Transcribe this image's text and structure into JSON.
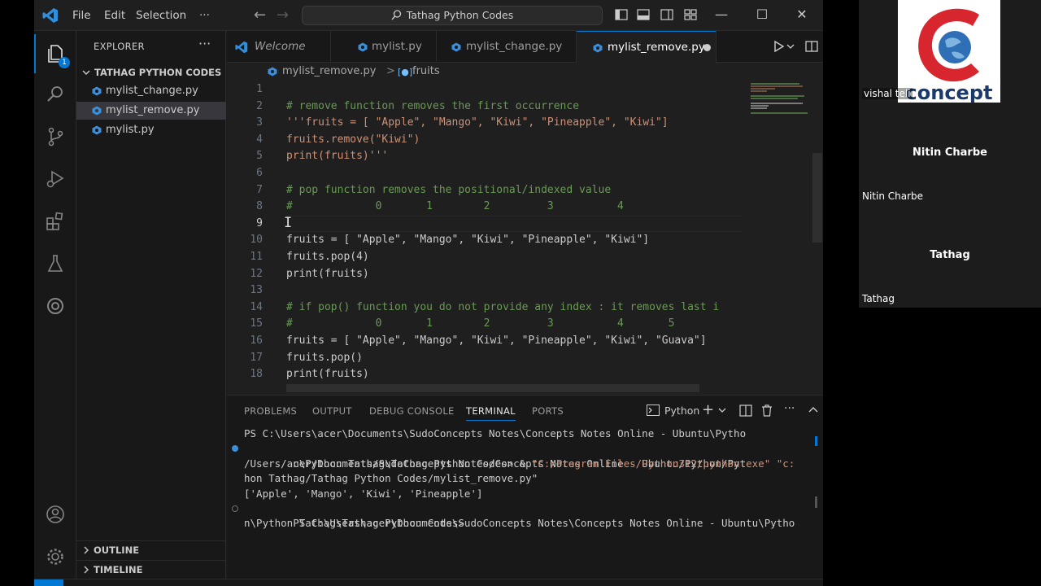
{
  "titlebar": {
    "menu": [
      "File",
      "Edit",
      "Selection",
      "···"
    ],
    "search": "Tathag Python Codes",
    "window_controls": [
      "minimize",
      "maximize",
      "close"
    ]
  },
  "activity_bar": {
    "items": [
      "explorer-icon",
      "search-icon",
      "source-control-icon",
      "run-debug-icon",
      "extensions-icon",
      "testing-icon",
      "remote-icon"
    ],
    "badge": "1",
    "bottom": [
      "account-icon",
      "gear-icon"
    ]
  },
  "sidebar": {
    "header": "EXPLORER",
    "more": "···",
    "folder": "TATHAG PYTHON CODES",
    "files": [
      "mylist_change.py",
      "mylist_remove.py",
      "mylist.py"
    ],
    "selected": "mylist_remove.py",
    "sections": [
      "OUTLINE",
      "TIMELINE"
    ]
  },
  "tabs": [
    {
      "label": "Welcome",
      "active": false
    },
    {
      "label": "mylist.py",
      "active": false
    },
    {
      "label": "mylist_change.py",
      "active": false
    },
    {
      "label": "mylist_remove.py",
      "active": true,
      "modified": true
    }
  ],
  "breadcrumb": {
    "file": "mylist_remove.py",
    "separator": ">",
    "symbol": "fruits"
  },
  "editor": {
    "line_numbers": [
      "1",
      "2",
      "3",
      "4",
      "5",
      "6",
      "7",
      "8",
      "9",
      "10",
      "11",
      "12",
      "13",
      "14",
      "15",
      "16",
      "17",
      "18"
    ],
    "current_line": "9",
    "lines": [
      "",
      "# remove function removes the first occurrence",
      "'''fruits = [ \"Apple\", \"Mango\", \"Kiwi\", \"Pineapple\", \"Kiwi\"]",
      "fruits.remove(\"Kiwi\")",
      "print(fruits)'''",
      "",
      "# pop function removes the positional/indexed value",
      "#             0       1        2         3          4",
      "",
      "fruits = [ \"Apple\", \"Mango\", \"Kiwi\", \"Pineapple\", \"Kiwi\"]",
      "fruits.pop(4)",
      "print(fruits)",
      "",
      "# if pop() function you do not provide any index : it removes last i",
      "#             0       1        2         3          4       5",
      "fruits = [ \"Apple\", \"Mango\", \"Kiwi\", \"Pineapple\", \"Kiwi\", \"Guava\"]",
      "fruits.pop()",
      "print(fruits)"
    ]
  },
  "panel": {
    "tabs": [
      "PROBLEMS",
      "OUTPUT",
      "DEBUG CONSOLE",
      "TERMINAL",
      "PORTS"
    ],
    "active_tab": "TERMINAL",
    "terminal_profile": "Python",
    "terminal": [
      "PS C:\\Users\\acer\\Documents\\SudoConcepts Notes\\Concepts Notes Online - Ubuntu\\Pytho",
      "n\\Python Tathag\\Tathag Python Codes> & ",
      "\"C:/Program Files/Python312/python.exe\" \"c:",
      "/Users/acer/Documents/SudoConcepts Notes/Concepts Notes Online - Ubuntu/Python/Pyt",
      "hon Tathag/Tathag Python Codes/mylist_remove.py\"",
      "['Apple', 'Mango', 'Kiwi', 'Pineapple']",
      "PS C:\\Users\\acer\\Documents\\SudoConcepts Notes\\Concepts Notes Online - Ubuntu\\Pytho",
      "n\\Python Tathag\\Tathag Python Codes>"
    ]
  },
  "participants": [
    {
      "label": "vishal teli",
      "center_name": "",
      "logo_text": "concept"
    },
    {
      "label": "Nitin Charbe",
      "center_name": "Nitin Charbe"
    },
    {
      "label": "Tathag",
      "center_name": "Tathag"
    }
  ],
  "colors": {
    "accent": "#0078d4",
    "comment": "#6a9955",
    "string": "#ce9178",
    "python_icon": "#3b8eda"
  }
}
